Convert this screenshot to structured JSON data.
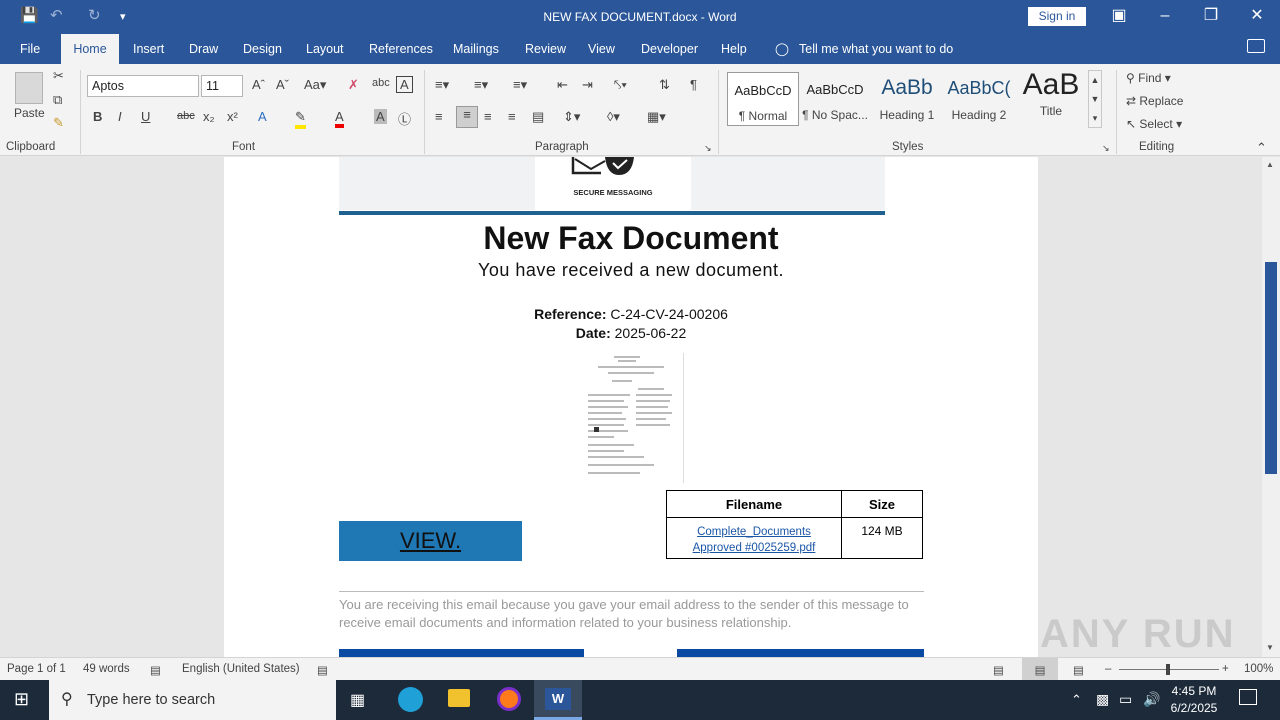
{
  "window": {
    "title": "NEW FAX DOCUMENT.docx  -  Word",
    "sign_in": "Sign in"
  },
  "tabs": [
    "File",
    "Home",
    "Insert",
    "Draw",
    "Design",
    "Layout",
    "References",
    "Mailings",
    "Review",
    "View",
    "Developer",
    "Help"
  ],
  "tell_me": "Tell me what you want to do",
  "ribbon": {
    "paste": "Paste",
    "font_name": "Aptos",
    "font_size": "11",
    "styles": [
      {
        "preview": "AaBbCcD",
        "name": "¶ Normal"
      },
      {
        "preview": "AaBbCcD",
        "name": "¶ No Spac..."
      },
      {
        "preview": "AaBb",
        "name": "Heading 1"
      },
      {
        "preview": "AaBbC(",
        "name": "Heading 2"
      },
      {
        "preview": "AaB",
        "name": "Title"
      }
    ],
    "find": "Find",
    "replace": "Replace",
    "select": "Select",
    "groups": {
      "clipboard": "Clipboard",
      "font": "Font",
      "paragraph": "Paragraph",
      "styles": "Styles",
      "editing": "Editing"
    }
  },
  "document": {
    "logo_text": "SECURE MESSAGING",
    "title": "New Fax Document",
    "subtitle": "You have received a new document.",
    "reference_label": "Reference:",
    "reference_value": "C-24-CV-24-00206",
    "date_label": "Date:",
    "date_value": "2025-06-22",
    "view_button": "VIEW.",
    "table": {
      "headers": [
        "Filename",
        "Size"
      ],
      "file_link": "Complete_Documents Approved #0025259.pdf",
      "size": "124 MB"
    },
    "notice": "You are receiving this email because you gave your email address to the sender of this message to receive email documents and information related to your business relationship."
  },
  "status": {
    "page": "Page 1 of 1",
    "words": "49 words",
    "language": "English (United States)",
    "zoom": "100%"
  },
  "taskbar": {
    "search_placeholder": "Type here to search",
    "time": "4:45 PM",
    "date": "6/2/2025"
  },
  "watermark": "ANY RUN"
}
